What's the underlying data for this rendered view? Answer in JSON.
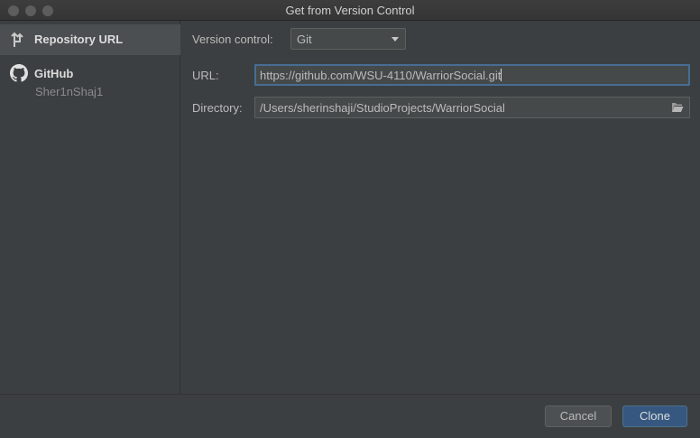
{
  "window": {
    "title": "Get from Version Control"
  },
  "sidebar": {
    "items": [
      {
        "label": "Repository URL",
        "icon": "vcs-branch-icon",
        "selected": true
      },
      {
        "label": "GitHub",
        "sublabel": "Sher1nShaj1",
        "icon": "github-icon",
        "selected": false
      }
    ]
  },
  "form": {
    "version_control_label": "Version control:",
    "version_control_value": "Git",
    "url_label": "URL:",
    "url_value": "https://github.com/WSU-4110/WarriorSocial.git",
    "directory_label": "Directory:",
    "directory_value": "/Users/sherinshaji/StudioProjects/WarriorSocial"
  },
  "footer": {
    "cancel_label": "Cancel",
    "clone_label": "Clone"
  },
  "colors": {
    "accent": "#365880",
    "focus_border": "#466d94",
    "background": "#3c3f41"
  }
}
